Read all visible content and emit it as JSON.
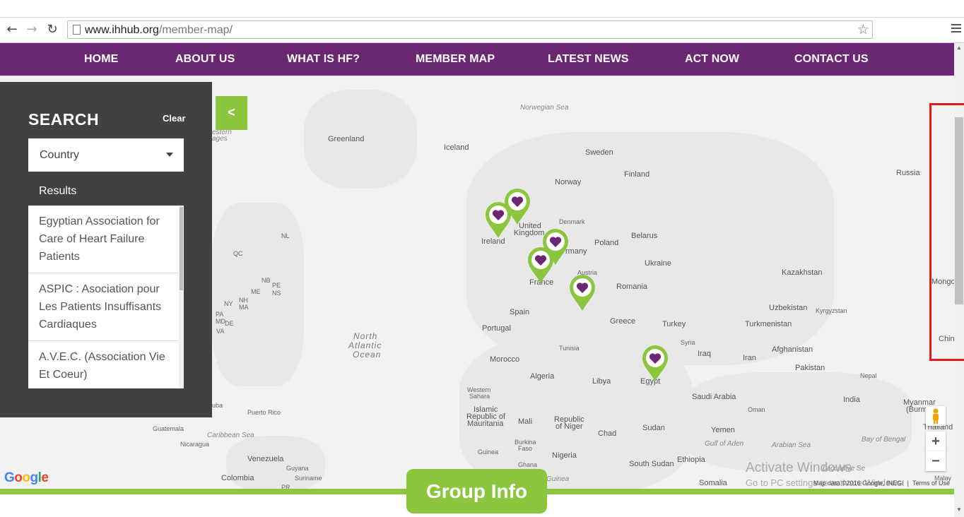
{
  "browser": {
    "url_domain": "www.ihhub.org",
    "url_path": "/member-map/"
  },
  "nav": {
    "items": [
      "HOME",
      "ABOUT US",
      "WHAT IS HF?",
      "MEMBER MAP",
      "LATEST NEWS",
      "ACT NOW",
      "CONTACT US"
    ]
  },
  "sidebar": {
    "title": "SEARCH",
    "clear_label": "Clear",
    "country_select": "Country",
    "results_label": "Results",
    "results": [
      "Egyptian Association for Care of Heart Failure Patients",
      "ASPIC : Asociation pour Les Patients Insuffisants Cardiaques",
      "A.V.E.C. (Association Vie Et Coeur)"
    ],
    "toggle_label": "<"
  },
  "map": {
    "labels": {
      "norwegian_sea": "Norwegian Sea",
      "western_passages": "estern",
      "western_passages2": "ages",
      "greenland": "Greenland",
      "iceland": "Iceland",
      "sweden": "Sweden",
      "finland": "Finland",
      "norway": "Norway",
      "russia": "Russia",
      "united": "United",
      "kingdom": "Kingdom",
      "denmark": "Denmark",
      "ireland": "Ireland",
      "belarus": "Belarus",
      "poland": "Poland",
      "germany": "rmany",
      "ukraine": "Ukraine",
      "austria": "Austria",
      "france": "France",
      "romania": "Romania",
      "kazakhstan": "Kazakhstan",
      "mongolia": "Mongo",
      "spain": "Spain",
      "portugal": "Portugal",
      "greece": "Greece",
      "turkey": "Turkey",
      "uzbekistan": "Uzbekistan",
      "kyrgyzstan": "Kyrgyzstan",
      "turkmenistan": "Turkmenistan",
      "syria": "Syria",
      "iraq": "Iraq",
      "iran": "Iran",
      "afghanistan": "Afghanistan",
      "pakistan": "Pakistan",
      "china": "Chin",
      "tunisia": "Tunisia",
      "morocco": "Morocco",
      "algeria": "Algeria",
      "libya": "Libya",
      "egypt": "Egypt",
      "nepal": "Nepal",
      "saudi_arabia": "Saudi Arabia",
      "india": "India",
      "oman": "Oman",
      "myanmar": "Myanmar",
      "burma": "(Burm",
      "western_sahara": "Western",
      "western_sahara2": "Sahara",
      "mauritania": "Islamic",
      "mauritania2": "Republic of",
      "mauritania3": "Mauritania",
      "mali": "Mali",
      "niger": "Republic",
      "niger2": "of Niger",
      "chad": "Chad",
      "sudan": "Sudan",
      "yemen": "Yemen",
      "thailand": "Thailand",
      "gulf_of_aden": "Gulf of Aden",
      "arabian_sea": "Arabian Sea",
      "bay_of_bengal": "Bay of Bengal",
      "guinea": "Guinea",
      "burkina": "Burkina",
      "burkina2": "Faso",
      "nigeria": "Nigeria",
      "ghana": "Ghana",
      "guinea2": "Guinea",
      "south_sudan": "South Sudan",
      "ethiopia": "Ethiopia",
      "somalia": "Somalia",
      "laccadive": "Laccadive Se",
      "north_atlantic": "North",
      "north_atlantic2": "Atlantic",
      "north_atlantic3": "Ocean",
      "nl": "NL",
      "qc": "QC",
      "nb": "NB",
      "pe": "PE",
      "ns": "NS",
      "me": "ME",
      "ny": "NY",
      "nh": "NH",
      "ma": "MA",
      "pa": "PA",
      "md": "MD",
      "de": "DE",
      "va": "VA",
      "ba": "uba",
      "puerto_rico": "Puerto Rico",
      "guatemala": "Guatemala",
      "caribbean": "Caribbean Sea",
      "nicaragua": "Nicaragua",
      "venezuela": "Venezuela",
      "guyana": "Guyana",
      "suriname": "Suriname",
      "colombia": "Colombia",
      "pr": "PR",
      "malay": "Malay"
    },
    "google_logo": "Google",
    "attribution": "Map data ©2016 Google, INEGI",
    "terms": "Terms of Use",
    "zoom_in": "+",
    "zoom_out": "−",
    "watermark_line1": "Activate Windows",
    "watermark_line2": "Go to PC settings to activate Windows."
  },
  "footer": {
    "group_info": "Group Info"
  },
  "colors": {
    "purple": "#6b2774",
    "green": "#8cc63f",
    "sidebar_bg": "#414141"
  }
}
